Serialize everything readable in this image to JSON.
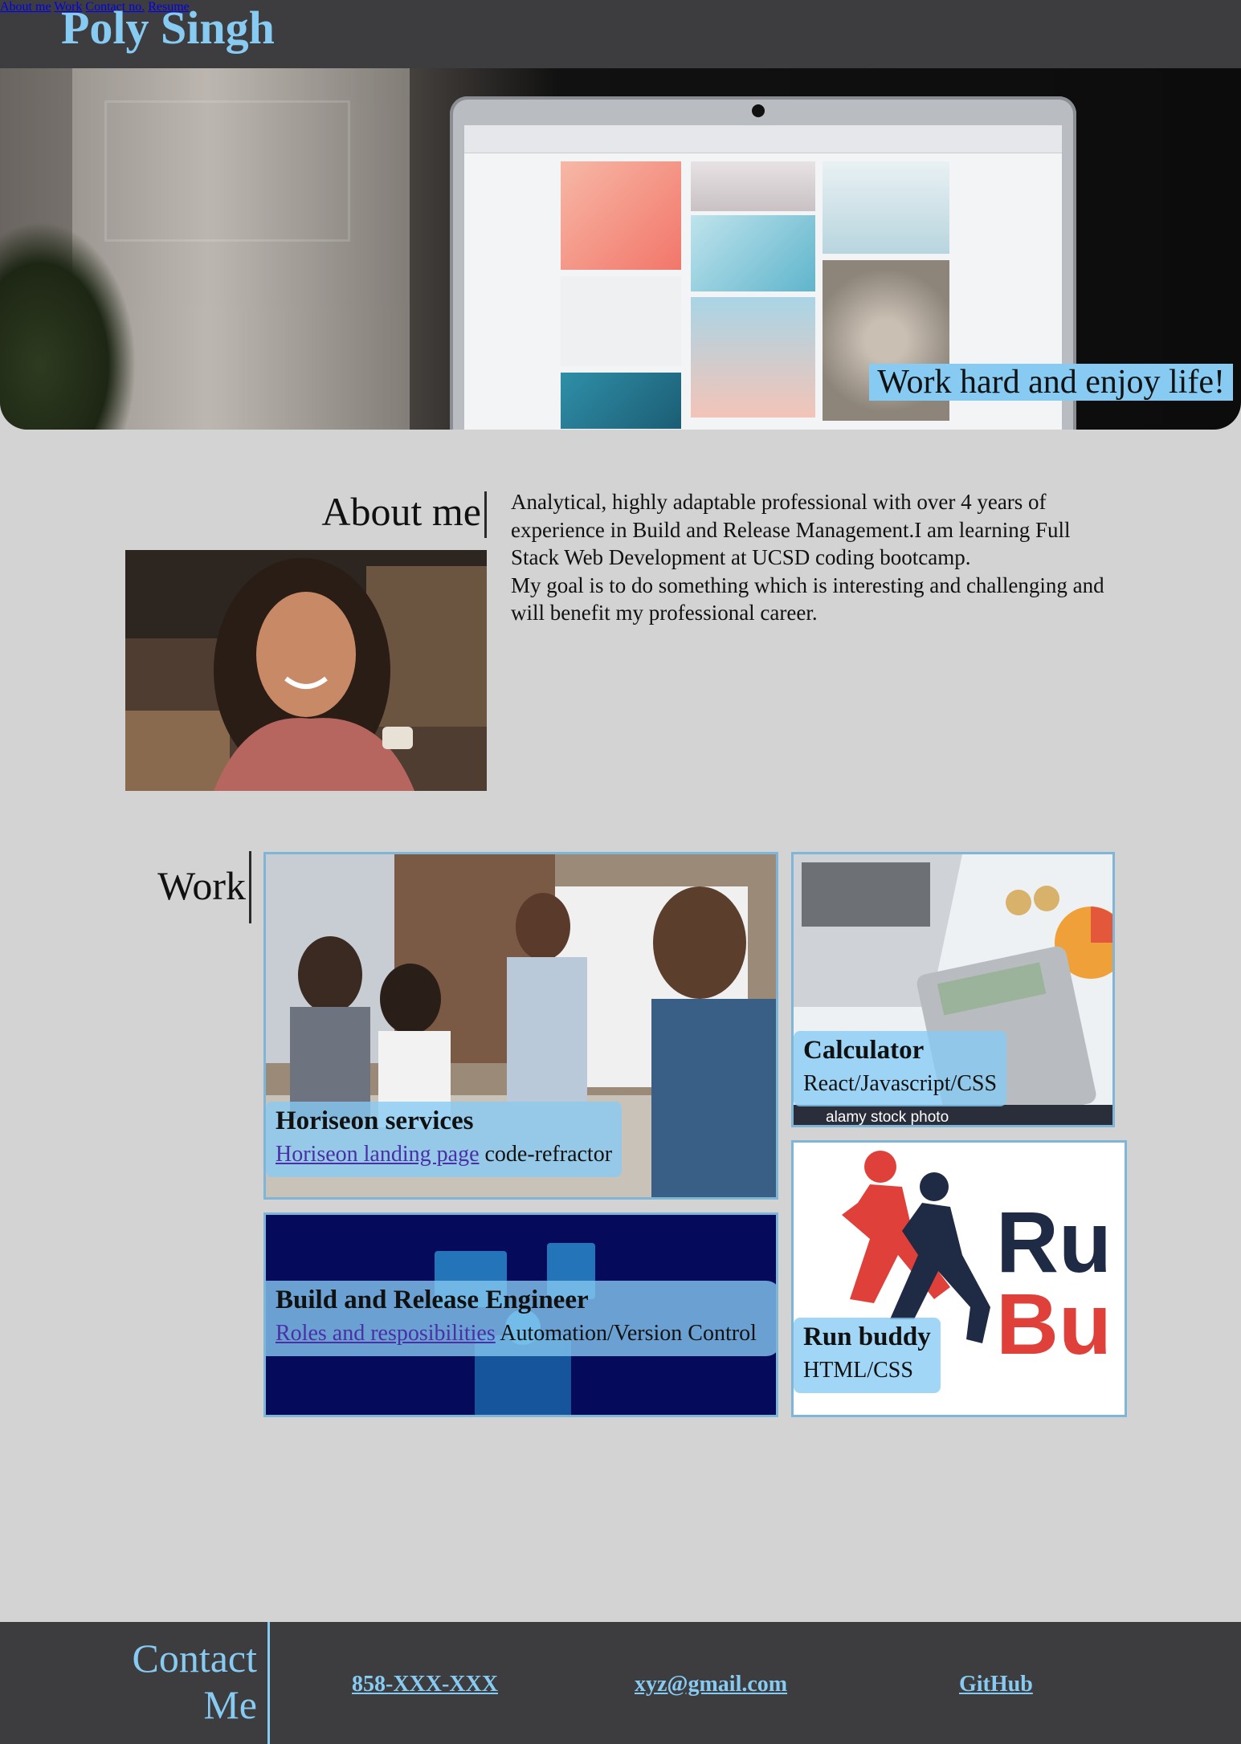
{
  "header": {
    "brand": "Poly Singh",
    "nav": [
      {
        "label": "About me"
      },
      {
        "label": "Work"
      },
      {
        "label": "Contact no."
      },
      {
        "label": "Resume"
      }
    ]
  },
  "hero": {
    "tagline": "Work hard and enjoy life!"
  },
  "about": {
    "title": "About me",
    "paragraph1": "Analytical, highly adaptable professional with over 4 years of experience in Build and Release Management.I am learning Full Stack Web Development at UCSD coding bootcamp.",
    "paragraph2": "My goal is to do something which is interesting and challenging and will benefit my professional career."
  },
  "work": {
    "title": "Work",
    "projects": [
      {
        "title": "Horiseon services",
        "link": "Horiseon landing page",
        "desc": " code-refractor"
      },
      {
        "title": "Calculator",
        "desc": "React/Javascript/CSS",
        "watermark": "alamy stock photo"
      },
      {
        "title": "Build and Release Engineer",
        "link": "Roles and resposibilities",
        "desc": " Automation/Version Control"
      },
      {
        "title": "Run buddy",
        "desc": "HTML/CSS",
        "logo_text_1": "Ru",
        "logo_text_2": "Bu"
      }
    ]
  },
  "footer": {
    "title": "Contact Me",
    "phone": "858-XXX-XXX",
    "email": "xyz@gmail.com",
    "github": "GitHub"
  },
  "colors": {
    "accent": "#87cbf3",
    "header_bg": "#3d3d3f",
    "page_bg": "#d3d3d3",
    "link": "#4b2fa6"
  }
}
